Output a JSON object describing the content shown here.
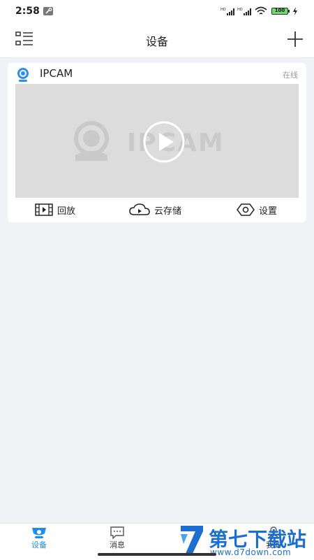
{
  "status_bar": {
    "time": "2:58",
    "battery": "100"
  },
  "header": {
    "title": "设备"
  },
  "device": {
    "name": "IPCAM",
    "status": "在线",
    "watermark": "IPCAM",
    "actions": [
      {
        "label": "回放",
        "icon": "playback-film-icon"
      },
      {
        "label": "云存储",
        "icon": "cloud-play-icon"
      },
      {
        "label": "设置",
        "icon": "settings-hexagon-icon"
      }
    ]
  },
  "tabs": [
    {
      "label": "设备",
      "icon": "camera-icon",
      "active": true
    },
    {
      "label": "消息",
      "icon": "message-icon",
      "active": false
    },
    {
      "label": "",
      "icon": "",
      "active": false
    },
    {
      "label": "我的",
      "icon": "profile-icon",
      "active": false
    }
  ],
  "watermark_site": {
    "text": "第七下载站",
    "url": "www.d7down.com"
  },
  "colors": {
    "accent": "#1c8cf0",
    "background": "#f1f2f5",
    "video_placeholder": "#dcdcdc"
  }
}
